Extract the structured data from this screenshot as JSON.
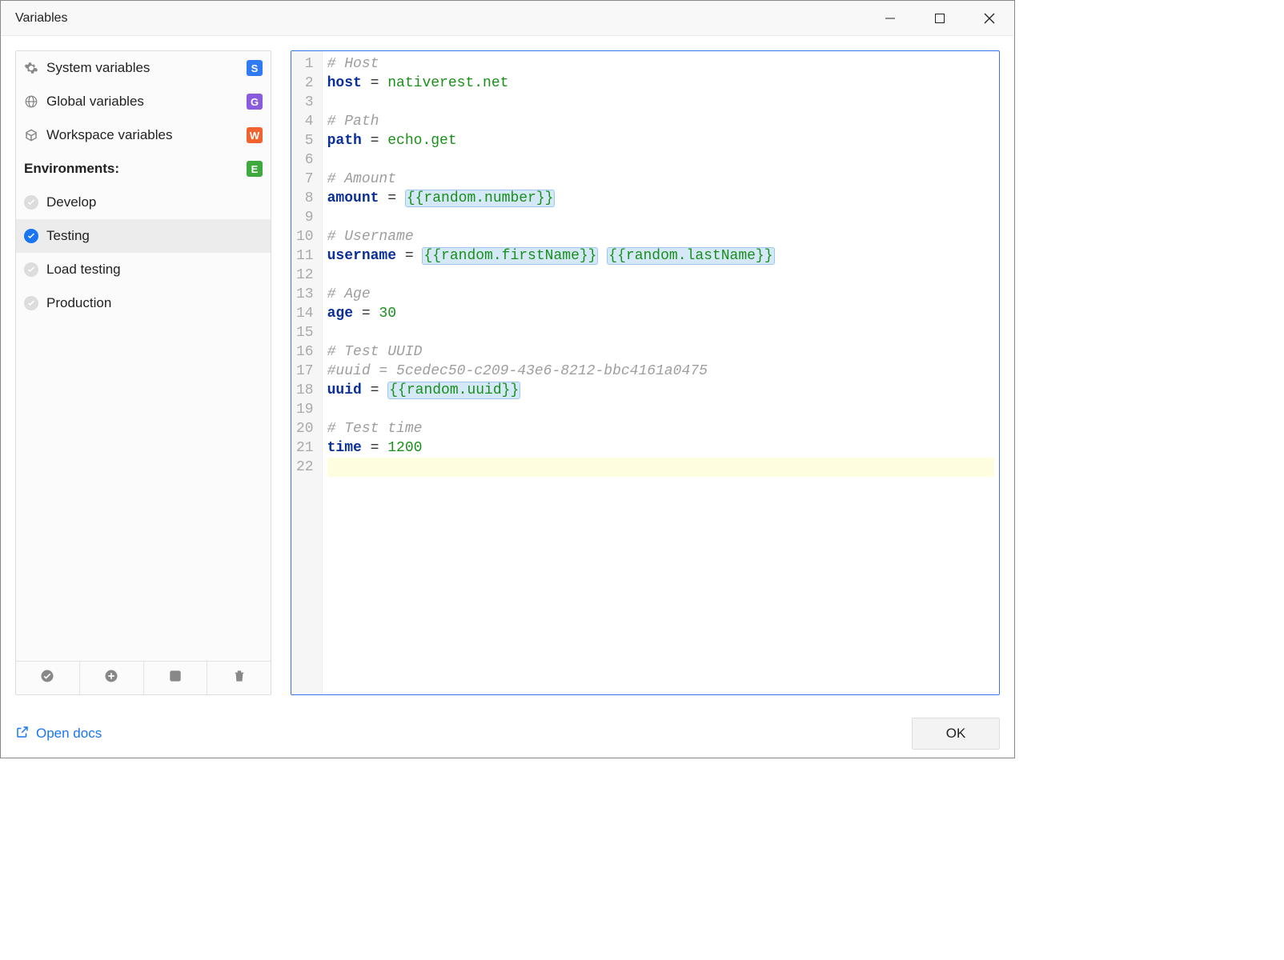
{
  "window": {
    "title": "Variables"
  },
  "sidebar": {
    "rows": [
      {
        "name": "sidebar-system-variables",
        "icon": "gear",
        "label": "System variables",
        "badge": {
          "text": "S",
          "color": "#2f7af5"
        },
        "interactable": true
      },
      {
        "name": "sidebar-global-variables",
        "icon": "globe",
        "label": "Global variables",
        "badge": {
          "text": "G",
          "color": "#8a5bdc"
        },
        "interactable": true
      },
      {
        "name": "sidebar-workspace-variables",
        "icon": "cube",
        "label": "Workspace variables",
        "badge": {
          "text": "W",
          "color": "#f2622e"
        },
        "interactable": true
      },
      {
        "name": "sidebar-environments-header",
        "header": true,
        "label": "Environments:",
        "badge": {
          "text": "E",
          "color": "#3eaa3e"
        },
        "interactable": false
      },
      {
        "name": "sidebar-env-develop",
        "env": true,
        "active": false,
        "label": "Develop",
        "interactable": true
      },
      {
        "name": "sidebar-env-testing",
        "env": true,
        "active": true,
        "label": "Testing",
        "interactable": true,
        "selected": true
      },
      {
        "name": "sidebar-env-load-testing",
        "env": true,
        "active": false,
        "label": "Load testing",
        "interactable": true
      },
      {
        "name": "sidebar-env-production",
        "env": true,
        "active": false,
        "label": "Production",
        "interactable": true
      }
    ],
    "toolbar": [
      {
        "name": "toggle-active",
        "icon": "check"
      },
      {
        "name": "add",
        "icon": "plus"
      },
      {
        "name": "edit",
        "icon": "edit"
      },
      {
        "name": "delete",
        "icon": "trash"
      }
    ]
  },
  "editor": {
    "current_line": 22,
    "lines": [
      {
        "n": 1,
        "tokens": [
          {
            "t": "comment",
            "v": "# Host"
          }
        ]
      },
      {
        "n": 2,
        "tokens": [
          {
            "t": "key",
            "v": "host"
          },
          {
            "t": "eq",
            "v": " = "
          },
          {
            "t": "value",
            "v": "nativerest.net"
          }
        ]
      },
      {
        "n": 3,
        "tokens": []
      },
      {
        "n": 4,
        "tokens": [
          {
            "t": "comment",
            "v": "# Path"
          }
        ]
      },
      {
        "n": 5,
        "tokens": [
          {
            "t": "key",
            "v": "path"
          },
          {
            "t": "eq",
            "v": " = "
          },
          {
            "t": "value",
            "v": "echo.get"
          }
        ]
      },
      {
        "n": 6,
        "tokens": []
      },
      {
        "n": 7,
        "tokens": [
          {
            "t": "comment",
            "v": "# Amount"
          }
        ]
      },
      {
        "n": 8,
        "tokens": [
          {
            "t": "key",
            "v": "amount"
          },
          {
            "t": "eq",
            "v": " = "
          },
          {
            "t": "template",
            "v": "{{random.number}}"
          }
        ]
      },
      {
        "n": 9,
        "tokens": []
      },
      {
        "n": 10,
        "tokens": [
          {
            "t": "comment",
            "v": "# Username"
          }
        ]
      },
      {
        "n": 11,
        "tokens": [
          {
            "t": "key",
            "v": "username"
          },
          {
            "t": "eq",
            "v": " = "
          },
          {
            "t": "template",
            "v": "{{random.firstName}}"
          },
          {
            "t": "eq",
            "v": " "
          },
          {
            "t": "template",
            "v": "{{random.lastName}}"
          }
        ]
      },
      {
        "n": 12,
        "tokens": []
      },
      {
        "n": 13,
        "tokens": [
          {
            "t": "comment",
            "v": "# Age"
          }
        ]
      },
      {
        "n": 14,
        "tokens": [
          {
            "t": "key",
            "v": "age"
          },
          {
            "t": "eq",
            "v": " = "
          },
          {
            "t": "value",
            "v": "30"
          }
        ]
      },
      {
        "n": 15,
        "tokens": []
      },
      {
        "n": 16,
        "tokens": [
          {
            "t": "comment",
            "v": "# Test UUID"
          }
        ]
      },
      {
        "n": 17,
        "tokens": [
          {
            "t": "comment",
            "v": "#uuid = 5cedec50-c209-43e6-8212-bbc4161a0475"
          }
        ]
      },
      {
        "n": 18,
        "tokens": [
          {
            "t": "key",
            "v": "uuid"
          },
          {
            "t": "eq",
            "v": " = "
          },
          {
            "t": "template",
            "v": "{{random.uuid}}"
          }
        ]
      },
      {
        "n": 19,
        "tokens": []
      },
      {
        "n": 20,
        "tokens": [
          {
            "t": "comment",
            "v": "# Test time"
          }
        ]
      },
      {
        "n": 21,
        "tokens": [
          {
            "t": "key",
            "v": "time"
          },
          {
            "t": "eq",
            "v": " = "
          },
          {
            "t": "value",
            "v": "1200"
          }
        ]
      },
      {
        "n": 22,
        "tokens": []
      }
    ]
  },
  "footer": {
    "open_docs_label": "Open docs",
    "ok_label": "OK"
  }
}
